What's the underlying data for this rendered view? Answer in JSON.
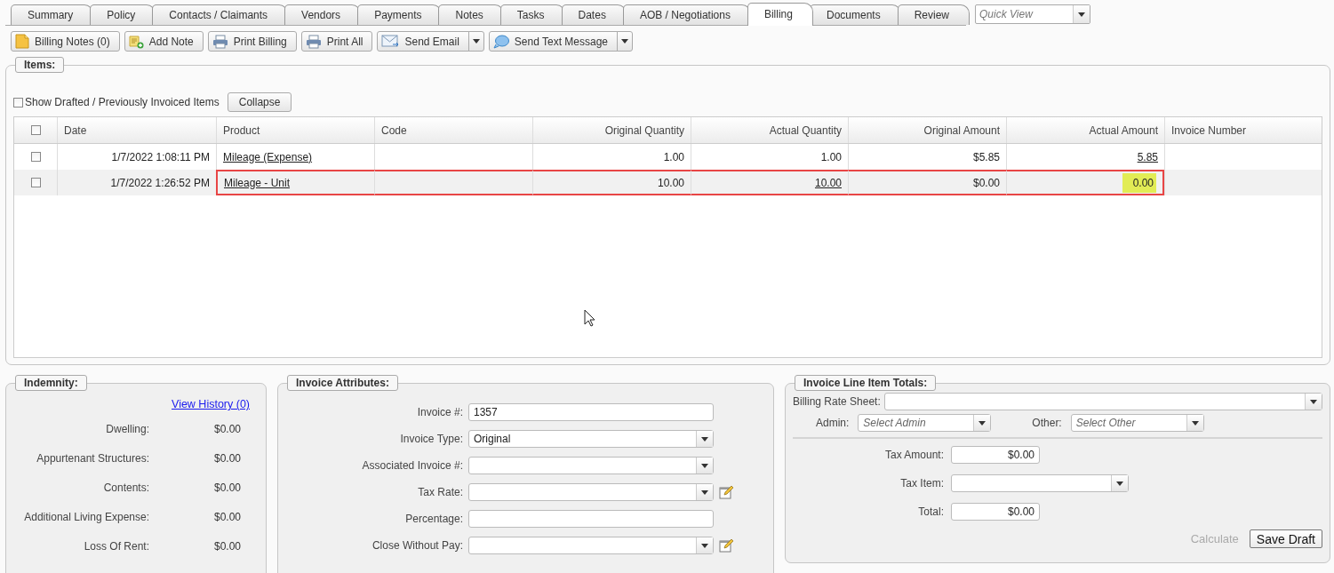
{
  "tabs": [
    {
      "label": "Summary",
      "selected": false
    },
    {
      "label": "Policy",
      "selected": false
    },
    {
      "label": "Contacts / Claimants",
      "selected": false
    },
    {
      "label": "Vendors",
      "selected": false
    },
    {
      "label": "Payments",
      "selected": false
    },
    {
      "label": "Notes",
      "selected": false
    },
    {
      "label": "Tasks",
      "selected": false
    },
    {
      "label": "Dates",
      "selected": false
    },
    {
      "label": "AOB / Negotiations",
      "selected": false
    },
    {
      "label": "Billing",
      "selected": true
    },
    {
      "label": "Documents",
      "selected": false
    },
    {
      "label": "Review",
      "selected": false
    }
  ],
  "quick_view": {
    "placeholder": "Quick View"
  },
  "toolbar": [
    {
      "label": "Billing Notes (0)",
      "kind": "notes",
      "dropdown": false
    },
    {
      "label": "Add Note",
      "kind": "add-note",
      "dropdown": false
    },
    {
      "label": "Print Billing",
      "kind": "print",
      "dropdown": false
    },
    {
      "label": "Print All",
      "kind": "print",
      "dropdown": false
    },
    {
      "label": "Send Email",
      "kind": "email",
      "dropdown": true
    },
    {
      "label": "Send Text Message",
      "kind": "chat",
      "dropdown": true
    }
  ],
  "items": {
    "title": "Items:",
    "show_drafted": {
      "label": "Show Drafted / Previously Invoiced Items",
      "checked": false
    },
    "collapse_button": "Collapse",
    "table": {
      "select_all_checked": false,
      "columns": [
        {
          "label": "Date",
          "kind": "text"
        },
        {
          "label": "Product",
          "kind": "text"
        },
        {
          "label": "Code",
          "kind": "text"
        },
        {
          "label": "Original Quantity",
          "kind": "number"
        },
        {
          "label": "Actual Quantity",
          "kind": "number"
        },
        {
          "label": "Original Amount",
          "kind": "number"
        },
        {
          "label": "Actual Amount",
          "kind": "number"
        },
        {
          "label": "Invoice Number",
          "kind": "text"
        }
      ],
      "rows": [
        {
          "checked": false,
          "hovered": false,
          "cells": [
            {
              "text": "1/7/2022 1:08:11 PM",
              "kind": "plain",
              "outlined": false
            },
            {
              "text": "Mileage (Expense)",
              "kind": "link",
              "outlined": false
            },
            {
              "outlined": false
            },
            {
              "text": "1.00",
              "kind": "plain",
              "outlined": false
            },
            {
              "text": "1.00",
              "kind": "plain",
              "outlined": false
            },
            {
              "text": "$5.85",
              "kind": "plain",
              "outlined": false
            },
            {
              "text": "5.85",
              "kind": "link",
              "outlined": false
            },
            {
              "outlined": false
            }
          ]
        },
        {
          "checked": false,
          "hovered": true,
          "cells": [
            {
              "text": "1/7/2022 1:26:52 PM",
              "kind": "plain",
              "outlined": false
            },
            {
              "text": "Mileage - Unit",
              "kind": "link",
              "outlined": true
            },
            {
              "outlined": true
            },
            {
              "text": "10.00",
              "kind": "plain",
              "outlined": true
            },
            {
              "text": "10.00",
              "kind": "link",
              "outlined": true
            },
            {
              "text": "$0.00",
              "kind": "plain",
              "outlined": true
            },
            {
              "text": "0.00",
              "kind": "highlighted",
              "outlined": true
            },
            {
              "outlined": false
            }
          ]
        }
      ]
    }
  },
  "indemnity": {
    "title": "Indemnity:",
    "link": "View History (0)",
    "rows": [
      {
        "label": "Dwelling:",
        "value": "$0.00"
      },
      {
        "label": "Appurtenant Structures:",
        "value": "$0.00"
      },
      {
        "label": "Contents:",
        "value": "$0.00"
      },
      {
        "label": "Additional Living Expense:",
        "value": "$0.00"
      },
      {
        "label": "Loss Of Rent:",
        "value": "$0.00"
      }
    ]
  },
  "invoice_attributes": {
    "title": "Invoice Attributes:",
    "fields": [
      {
        "label": "Invoice #:",
        "kind": "text",
        "value": "1357",
        "edit_icon": false
      },
      {
        "label": "Invoice Type:",
        "kind": "select",
        "value": "Original",
        "edit_icon": false
      },
      {
        "label": "Associated Invoice #:",
        "kind": "select",
        "edit_icon": false
      },
      {
        "label": "Tax Rate:",
        "kind": "select",
        "edit_icon": true
      },
      {
        "label": "Percentage:",
        "kind": "text",
        "edit_icon": false
      },
      {
        "label": "Close Without Pay:",
        "kind": "select",
        "edit_icon": true
      }
    ]
  },
  "line_item_totals": {
    "title": "Invoice Line Item Totals:",
    "billing_rate_sheet": {
      "label": "Billing Rate Sheet:"
    },
    "admin": {
      "label": "Admin:",
      "placeholder": "Select Admin"
    },
    "other": {
      "label": "Other:",
      "placeholder": "Select Other"
    },
    "fields": [
      {
        "label": "Tax Amount:",
        "kind": "text",
        "value": "$0.00"
      },
      {
        "label": "Tax Item:",
        "kind": "select"
      },
      {
        "label": "Total:",
        "kind": "text",
        "value": "$0.00"
      }
    ],
    "calculate": {
      "label": "Calculate",
      "disabled": true
    },
    "save_draft": {
      "label": "Save Draft",
      "disabled": false
    }
  }
}
